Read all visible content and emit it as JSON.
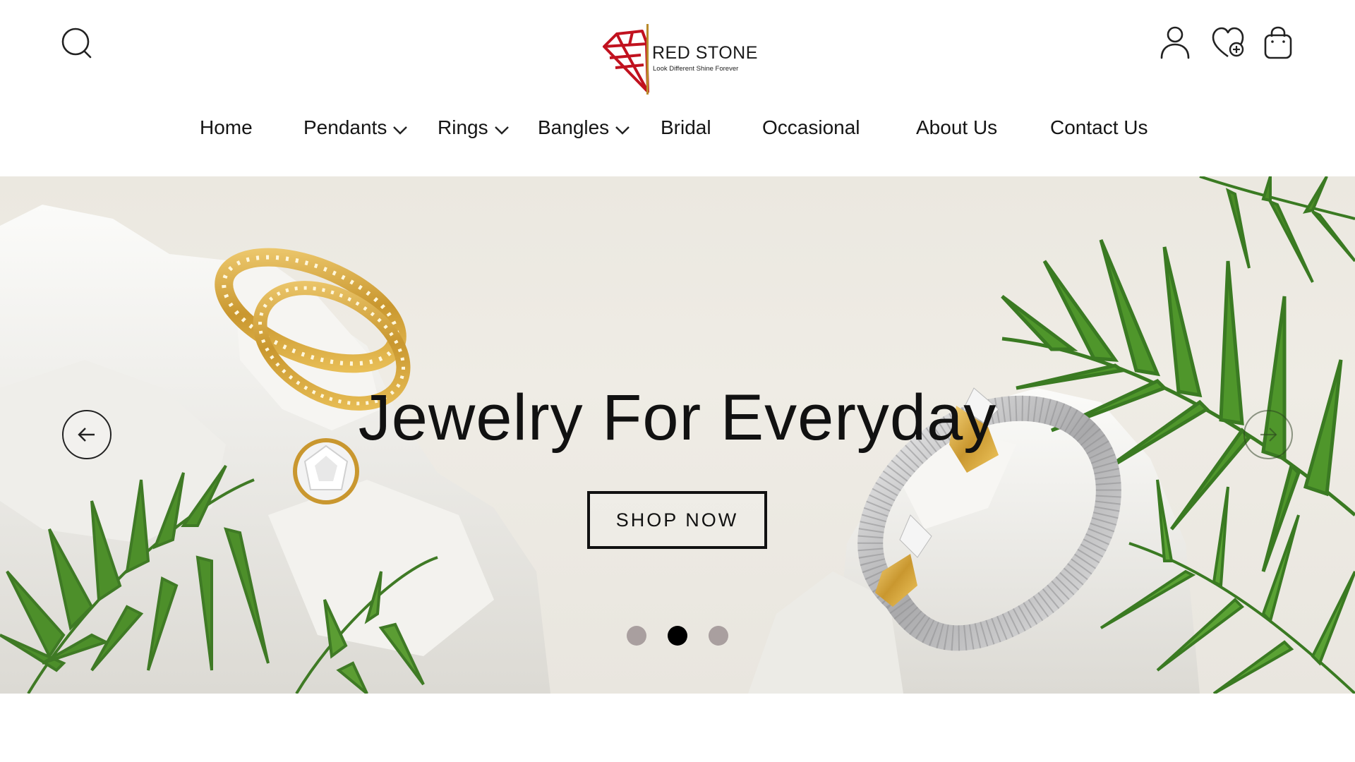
{
  "brand": {
    "name": "RED STONE",
    "tagline": "Look Different Shine Forever",
    "logo_color": "#c1121f",
    "accent_color": "#b98a2a"
  },
  "header": {
    "icons": {
      "search": "search-icon",
      "account": "user-icon",
      "wishlist": "heart-plus-icon",
      "bag": "shopping-bag-icon"
    }
  },
  "nav": {
    "items": [
      {
        "label": "Home",
        "has_dropdown": false
      },
      {
        "label": "Pendants",
        "has_dropdown": true
      },
      {
        "label": "Rings",
        "has_dropdown": true
      },
      {
        "label": "Bangles",
        "has_dropdown": true
      },
      {
        "label": "Bridal",
        "has_dropdown": false
      },
      {
        "label": "Occasional",
        "has_dropdown": false
      },
      {
        "label": "About Us",
        "has_dropdown": false
      },
      {
        "label": "Contact Us",
        "has_dropdown": false
      }
    ]
  },
  "hero": {
    "title": "Jewelry For Everyday",
    "cta_label": "SHOP  NOW",
    "prev_icon": "arrow-left-icon",
    "next_icon": "arrow-right-icon",
    "slides": {
      "count": 3,
      "active_index": 1,
      "active_color": "#000000",
      "inactive_color": "#a99f9f"
    }
  }
}
